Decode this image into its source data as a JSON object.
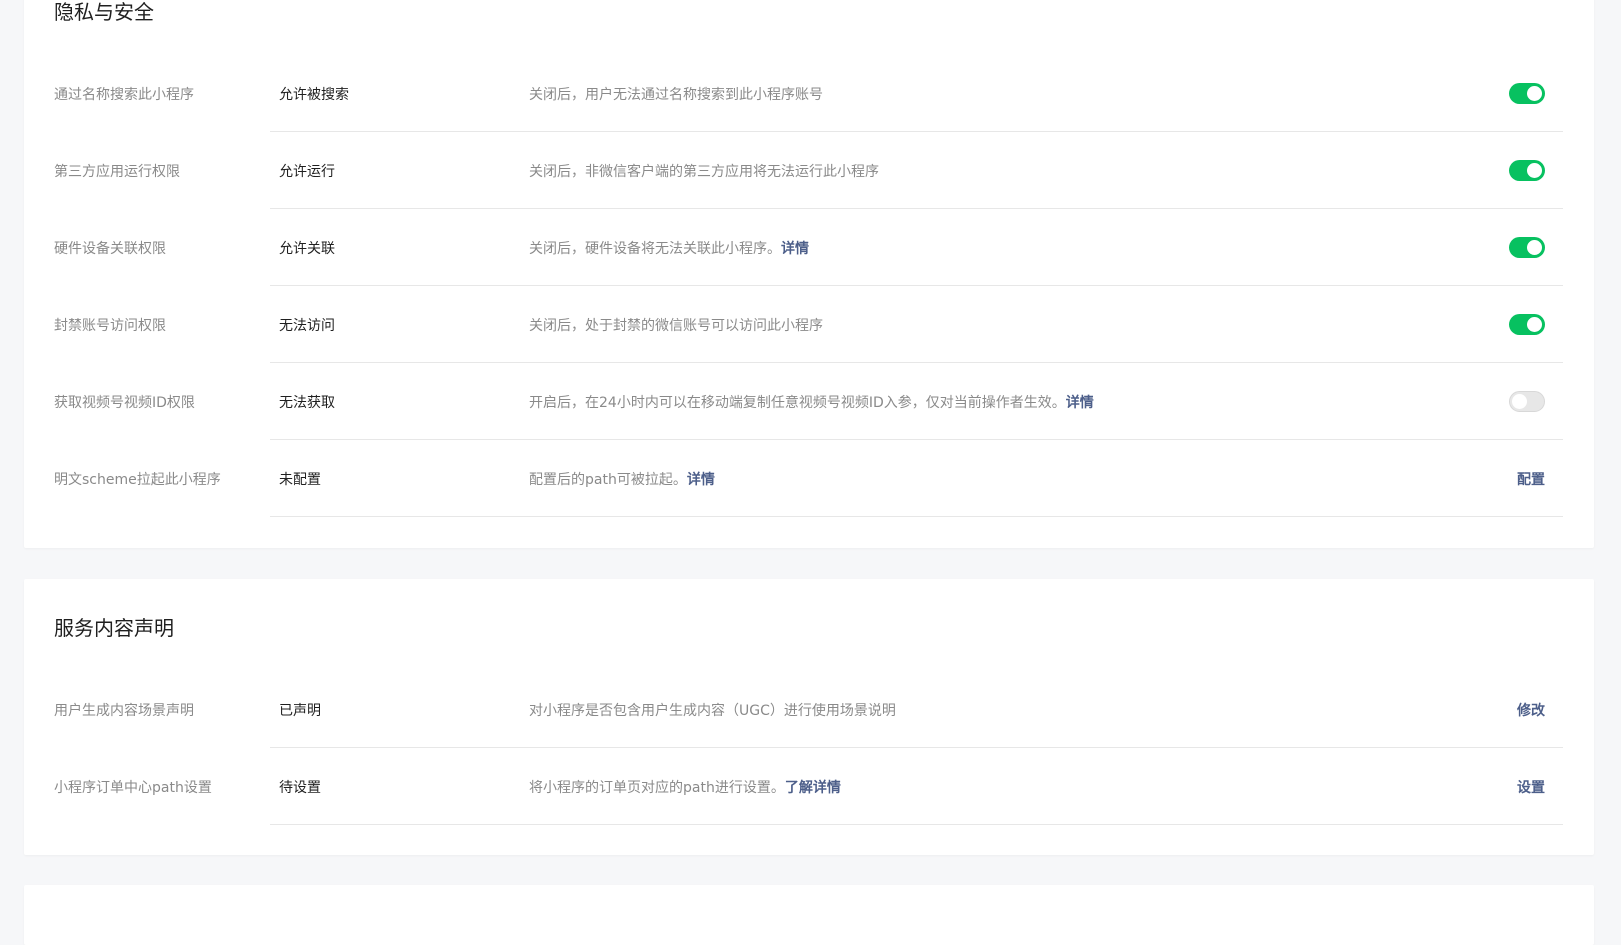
{
  "privacy": {
    "title": "隐私与安全",
    "rows": [
      {
        "label": "通过名称搜索此小程序",
        "value": "允许被搜索",
        "desc": "关闭后，用户无法通过名称搜索到此小程序账号",
        "desc_link": "",
        "switch_on": true
      },
      {
        "label": "第三方应用运行权限",
        "value": "允许运行",
        "desc": "关闭后，非微信客户端的第三方应用将无法运行此小程序",
        "desc_link": "",
        "switch_on": true
      },
      {
        "label": "硬件设备关联权限",
        "value": "允许关联",
        "desc": "关闭后，硬件设备将无法关联此小程序。",
        "desc_link": "详情",
        "switch_on": true
      },
      {
        "label": "封禁账号访问权限",
        "value": "无法访问",
        "desc": "关闭后，处于封禁的微信账号可以访问此小程序",
        "desc_link": "",
        "switch_on": true
      },
      {
        "label": "获取视频号视频ID权限",
        "value": "无法获取",
        "desc": "开启后，在24小时内可以在移动端复制任意视频号视频ID入参，仅对当前操作者生效。",
        "desc_link": "详情",
        "switch_on": false
      },
      {
        "label": "明文scheme拉起此小程序",
        "value": "未配置",
        "desc": "配置后的path可被拉起。",
        "desc_link": "详情",
        "action": "配置"
      }
    ]
  },
  "service": {
    "title": "服务内容声明",
    "rows": [
      {
        "label": "用户生成内容场景声明",
        "value": "已声明",
        "desc": "对小程序是否包含用户生成内容（UGC）进行使用场景说明",
        "desc_link": "",
        "action": "修改"
      },
      {
        "label": "小程序订单中心path设置",
        "value": "待设置",
        "desc": "将小程序的订单页对应的path进行设置。",
        "desc_link": "了解详情",
        "action": "设置"
      }
    ]
  },
  "colors": {
    "switch_on": "#07c160",
    "switch_off": "#e7e7e7",
    "link": "#4d5f8a",
    "page_bg": "#f6f7f9"
  }
}
